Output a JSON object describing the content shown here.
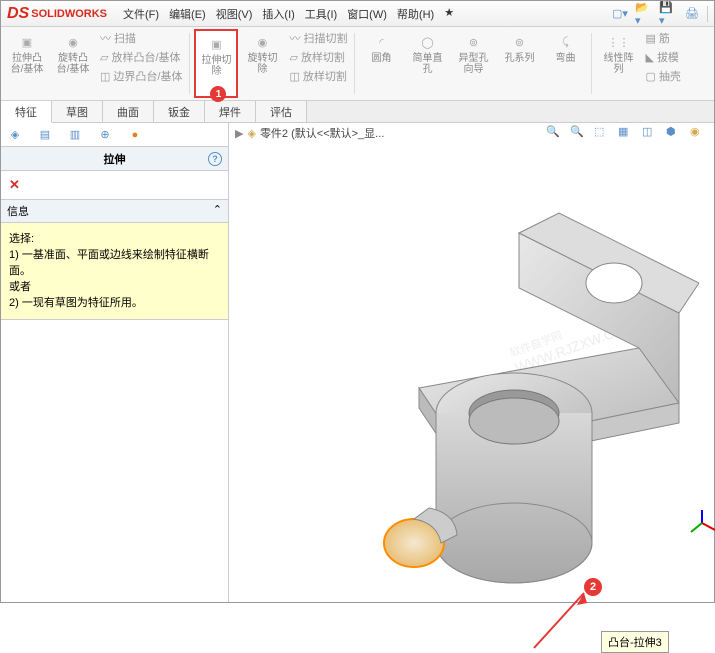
{
  "app": {
    "name": "SOLIDWORKS"
  },
  "menu": {
    "file": "文件(F)",
    "edit": "编辑(E)",
    "view": "视图(V)",
    "insert": "插入(I)",
    "tools": "工具(I)",
    "window": "窗口(W)",
    "help": "帮助(H)",
    "star": "★"
  },
  "ribbon": {
    "extrude_boss": "拉伸凸\n台/基体",
    "revolve_boss": "旋转凸\n台/基体",
    "sweep": "扫描",
    "loft": "放样凸台/基体",
    "boundary": "边界凸台/基体",
    "extrude_cut": "拉伸切\n除",
    "revolve_cut": "旋转切\n除",
    "sweep_cut": "扫描切割",
    "loft_cut": "放样切割",
    "boundary_cut": "放样切割",
    "fillet": "圆角",
    "simple_hole": "简单直\n孔",
    "hole_wizard": "异型孔\n向导",
    "hole_series": "孔系列",
    "bend": "弯曲",
    "linear_pattern": "线性阵\n列",
    "rib": "筋",
    "draft": "拔模",
    "shell": "抽壳"
  },
  "tabs": {
    "features": "特征",
    "sketch": "草图",
    "surfaces": "曲面",
    "sheetmetal": "钣金",
    "weldments": "焊件",
    "evaluate": "评估"
  },
  "panel": {
    "title": "拉伸",
    "info_header": "信息",
    "info_body": "选择:\n1) 一基准面、平面或边线来绘制特征横断面。\n或者\n2) 一现有草图为特征所用。"
  },
  "breadcrumb": {
    "part": "零件2 (默认<<默认>_显..."
  },
  "tooltip": {
    "text": "凸台-拉伸3"
  },
  "watermark": {
    "line1": "软件自学网",
    "line2": "WWW.RJZXW.COM"
  },
  "callouts": {
    "c1": "1",
    "c2": "2"
  }
}
